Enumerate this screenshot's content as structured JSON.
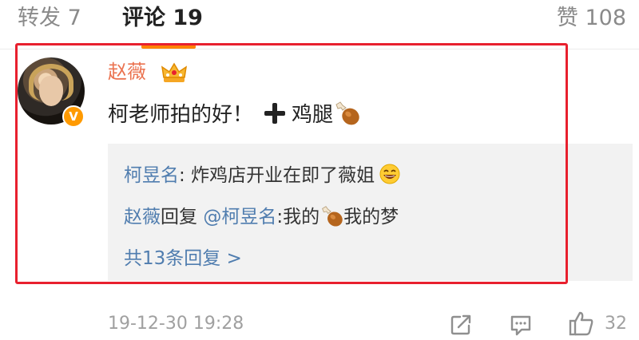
{
  "tabs": {
    "repost_label": "转发 7",
    "comment_label": "评论 19",
    "likes_label": "赞 108"
  },
  "comment": {
    "username": "赵薇",
    "text_main": "柯老师拍的好！",
    "text_after_plus": "鸡腿",
    "replies": [
      {
        "author": "柯昱名",
        "separator": ": ",
        "text": "炸鸡店开业在即了薇姐"
      },
      {
        "author": "赵薇",
        "reply_word": "回复",
        "mention": "@柯昱名",
        "separator": ":",
        "text_before_icon": "我的",
        "text_after_icon": "我的梦"
      }
    ],
    "more_replies": "共13条回复 >"
  },
  "footer": {
    "timestamp": "19-12-30 19:28",
    "like_count": "32"
  },
  "icons": {
    "verified_badge": "v-badge",
    "crown": "crown-icon",
    "plus": "plus-icon",
    "drumstick": "drumstick-icon",
    "grin": "grinning-face-icon",
    "share": "share-icon",
    "reply": "reply-icon",
    "like": "thumbs-up-icon"
  },
  "colors": {
    "accent": "#ff8200",
    "username": "#eb7350",
    "link": "#507daf",
    "highlight": "#e8202e",
    "muted": "#a0a0a0"
  }
}
